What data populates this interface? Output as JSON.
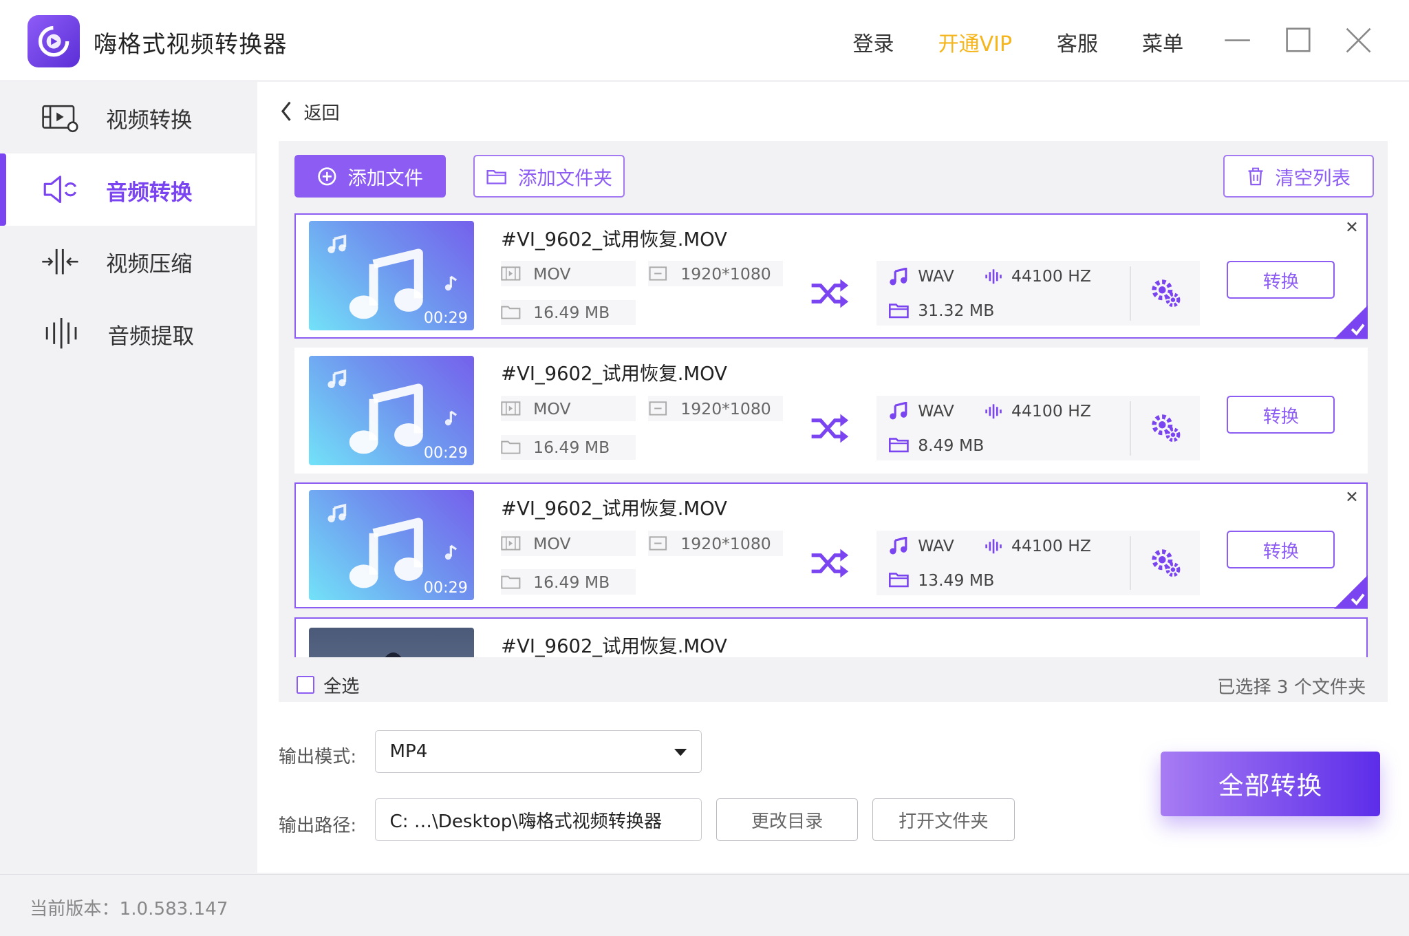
{
  "app": {
    "title": "嗨格式视频转换器"
  },
  "titlebar": {
    "login": "登录",
    "vip": "开通VIP",
    "service": "客服",
    "menu": "菜单"
  },
  "sidebar": {
    "items": [
      {
        "label": "视频转换"
      },
      {
        "label": "音频转换"
      },
      {
        "label": "视频压缩"
      },
      {
        "label": "音频提取"
      }
    ]
  },
  "main": {
    "back": "返回",
    "toolbar": {
      "add_file": "添加文件",
      "add_folder": "添加文件夹",
      "clear_list": "清空列表"
    },
    "files": [
      {
        "name": "#VI_9602_试用恢复.MOV",
        "duration": "00:29",
        "format": "MOV",
        "resolution": "1920*1080",
        "size": "16.49 MB",
        "out_format": "WAV",
        "out_rate": "44100 HZ",
        "out_size": "31.32 MB",
        "convert": "转换",
        "selected": true
      },
      {
        "name": "#VI_9602_试用恢复.MOV",
        "duration": "00:29",
        "format": "MOV",
        "resolution": "1920*1080",
        "size": "16.49 MB",
        "out_format": "WAV",
        "out_rate": "44100 HZ",
        "out_size": "8.49 MB",
        "convert": "转换",
        "selected": false
      },
      {
        "name": "#VI_9602_试用恢复.MOV",
        "duration": "00:29",
        "format": "MOV",
        "resolution": "1920*1080",
        "size": "16.49 MB",
        "out_format": "WAV",
        "out_rate": "44100 HZ",
        "out_size": "13.49 MB",
        "convert": "转换",
        "selected": true
      },
      {
        "name": "#VI_9602_试用恢复.MOV",
        "selected": true
      }
    ],
    "select_all": "全选",
    "selected_count": "已选择 3 个文件夹",
    "output": {
      "mode_label": "输出模式:",
      "mode_value": "MP4",
      "path_label": "输出路径:",
      "path_value": "C: …\\Desktop\\嗨格式视频转换器",
      "change_dir": "更改目录",
      "open_folder": "打开文件夹"
    },
    "convert_all": "全部转换"
  },
  "footer": {
    "version": "当前版本：1.0.583.147"
  },
  "colors": {
    "accent": "#8c5cf3",
    "vip": "#f5b51c"
  }
}
